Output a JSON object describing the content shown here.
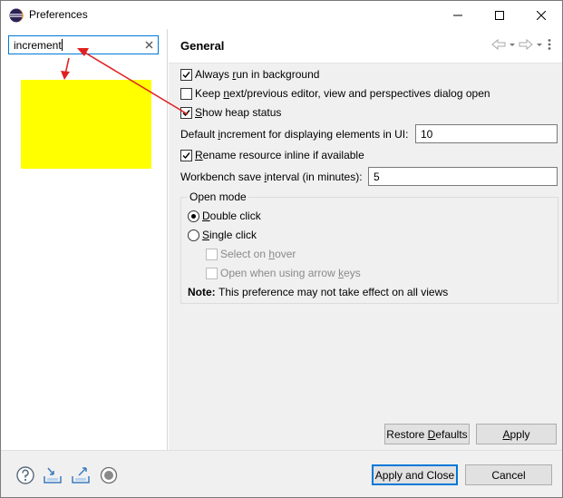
{
  "window": {
    "title": "Preferences"
  },
  "filter": {
    "value": "increment"
  },
  "page": {
    "title": "General"
  },
  "options": {
    "always_run_background": {
      "pre": "Always ",
      "key": "r",
      "post": "un in background",
      "checked": true
    },
    "keep_next_previous": {
      "pre": "Keep ",
      "key": "n",
      "post": "ext/previous editor, view and perspectives dialog open",
      "checked": false
    },
    "show_heap": {
      "pre": "",
      "key": "S",
      "post": "how heap status",
      "checked": true
    },
    "default_increment": {
      "pre": "Default ",
      "key": "i",
      "post": "ncrement for displaying elements in UI:",
      "value": "10"
    },
    "rename_inline": {
      "pre": "",
      "key": "R",
      "post": "ename resource inline if available",
      "checked": true
    },
    "save_interval": {
      "pre": "Workbench save ",
      "key": "i",
      "post": "nterval (in minutes):",
      "value": "5"
    }
  },
  "open_mode": {
    "title": "Open mode",
    "double_click": {
      "pre": "",
      "key": "D",
      "post": "ouble click",
      "selected": true
    },
    "single_click": {
      "pre": "",
      "key": "S",
      "post": "ingle click",
      "selected": false
    },
    "select_hover": {
      "pre": "Select on ",
      "key": "h",
      "post": "over",
      "checked": false
    },
    "open_arrow_keys": {
      "pre": "Open when using arrow ",
      "key": "k",
      "post": "eys",
      "checked": false
    },
    "note_label": "Note:",
    "note_text": "This preference may not take effect on all views"
  },
  "buttons": {
    "restore_defaults": {
      "pre": "Restore ",
      "key": "D",
      "post": "efaults"
    },
    "apply": {
      "pre": "",
      "key": "A",
      "post": "pply"
    },
    "apply_close": "Apply and Close",
    "cancel": "Cancel"
  },
  "icons": [
    "eclipse-icon",
    "minimize-icon",
    "maximize-icon",
    "close-icon",
    "clear-filter-icon",
    "back-icon",
    "back-menu-icon",
    "forward-icon",
    "forward-menu-icon",
    "view-menu-icon",
    "help-icon",
    "import-icon",
    "export-icon",
    "record-icon"
  ],
  "colors": {
    "accent": "#0078d7",
    "annotation_arrow": "#e02020",
    "highlight": "#ffff00"
  }
}
